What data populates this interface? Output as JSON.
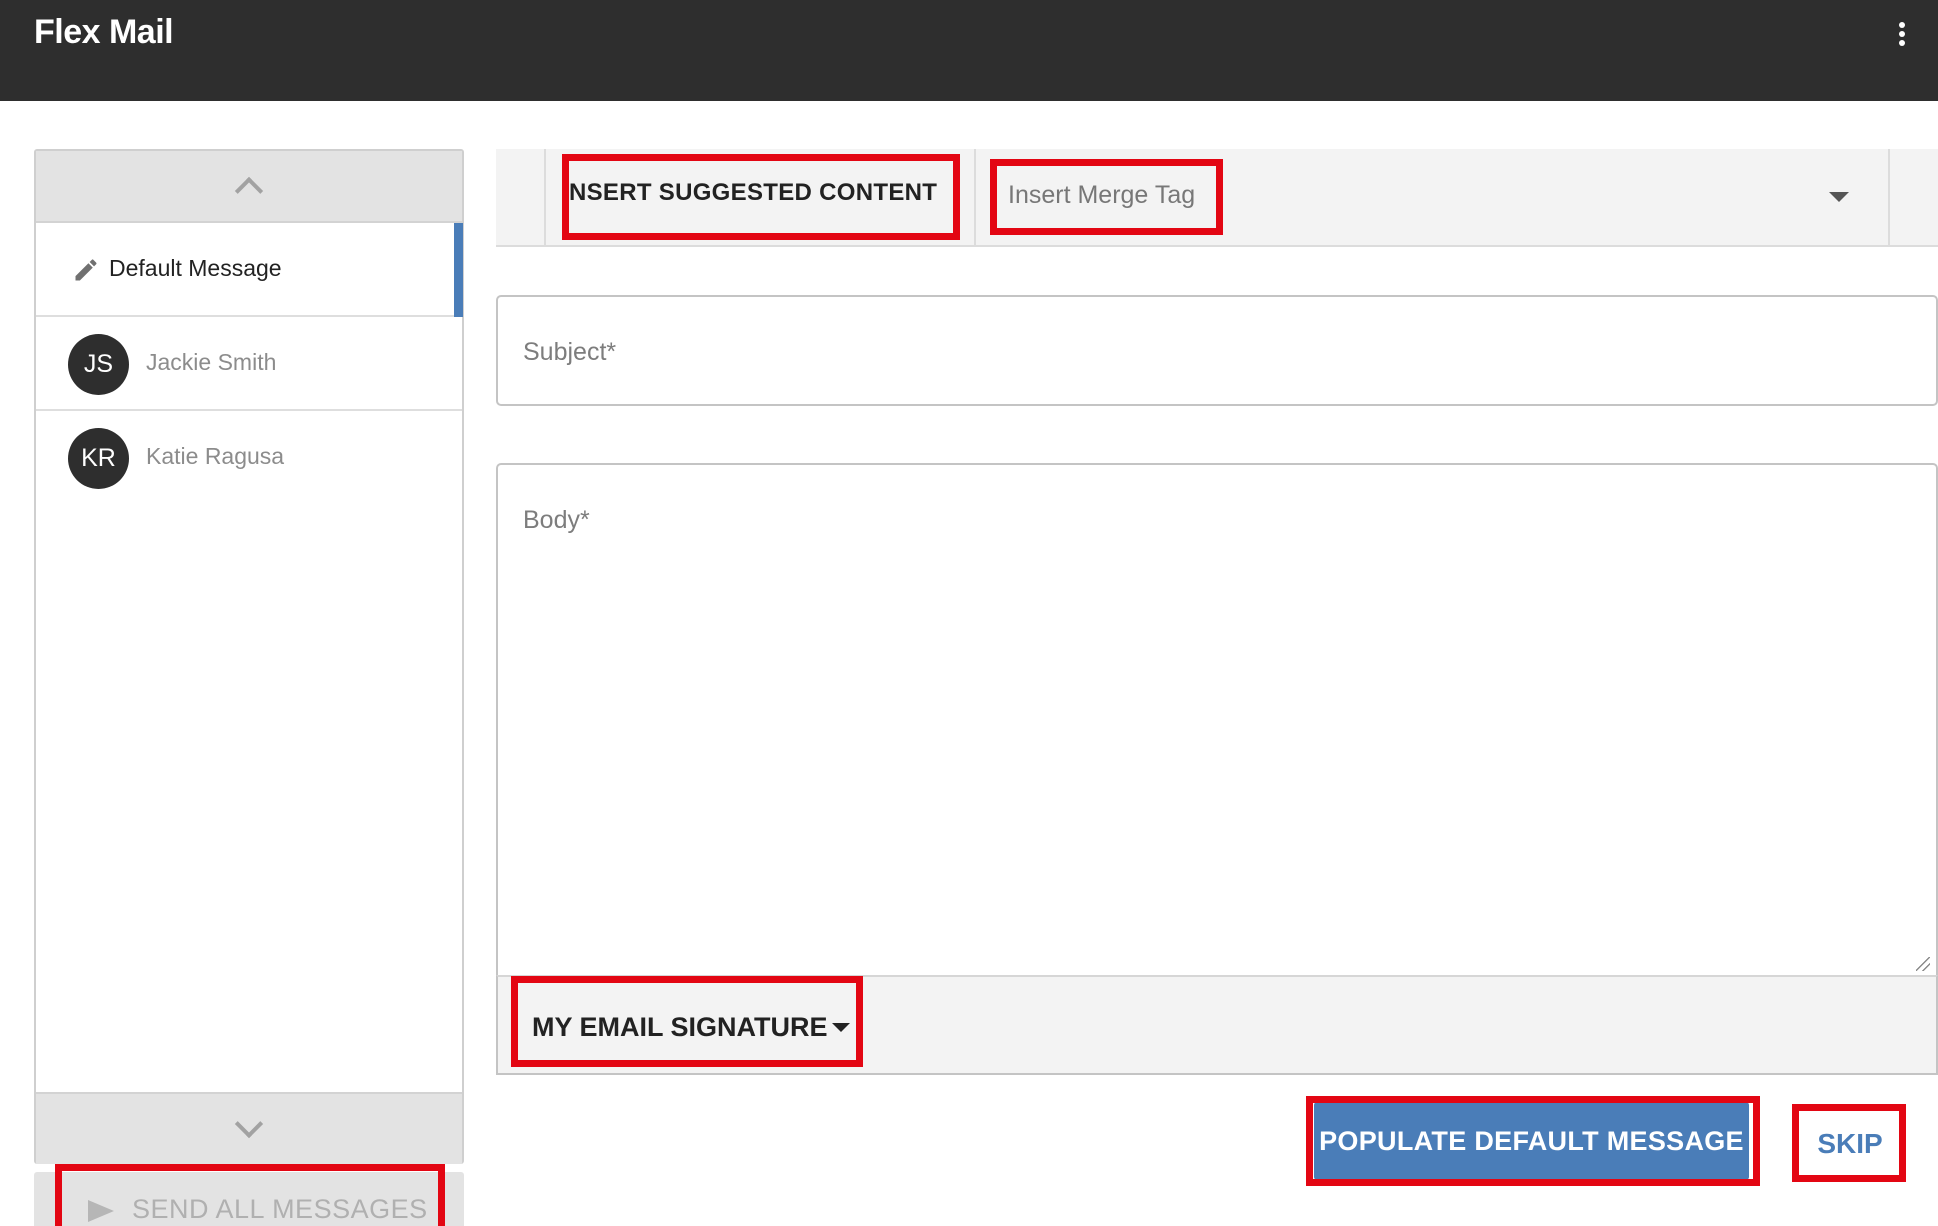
{
  "app": {
    "title": "Flex Mail",
    "menu_icon": "more-vert-icon"
  },
  "sidebar": {
    "default_item": {
      "label": "Default Message",
      "icon": "pencil-icon"
    },
    "contacts": [
      {
        "initials": "JS",
        "name": "Jackie Smith"
      },
      {
        "initials": "KR",
        "name": "Katie Ragusa"
      }
    ],
    "send_all_label": "SEND ALL MESSAGES"
  },
  "toolbar": {
    "suggested_label": "INSERT SUGGESTED CONTENT",
    "merge_tag_placeholder": "Insert Merge Tag"
  },
  "form": {
    "subject_placeholder": "Subject*",
    "subject_value": "",
    "body_placeholder": "Body*",
    "body_value": "",
    "signature_label": "MY EMAIL SIGNATURE"
  },
  "actions": {
    "populate_label": "POPULATE DEFAULT MESSAGE",
    "skip_label": "SKIP"
  },
  "colors": {
    "topbar": "#2e2e2e",
    "accent": "#4a7db8",
    "highlight": "#e30613",
    "panel": "#e3e3e3"
  }
}
